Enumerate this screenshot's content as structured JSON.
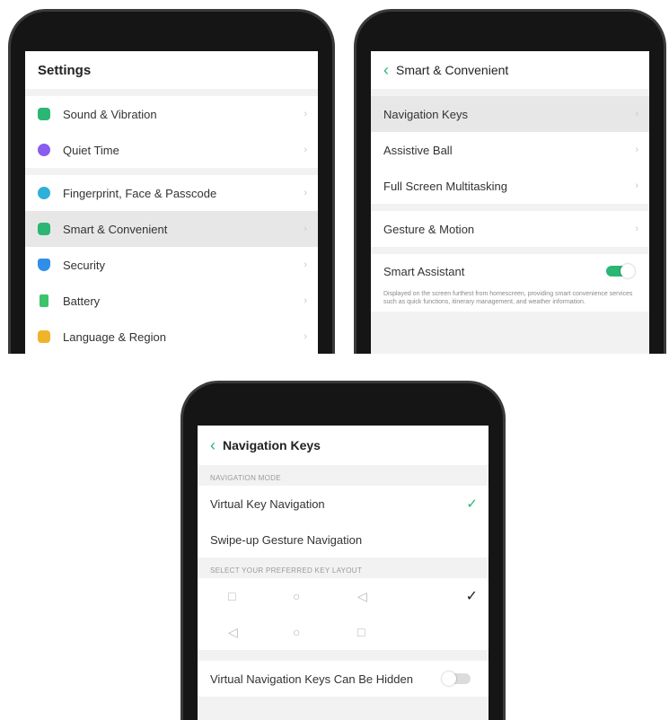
{
  "colors": {
    "accent": "#2bb673"
  },
  "phone1": {
    "title": "Settings",
    "group1": [
      {
        "label": "Sound & Vibration",
        "icon": "speaker-icon",
        "color": "#2bb673"
      },
      {
        "label": "Quiet Time",
        "icon": "moon-icon",
        "color": "#8a5cf0"
      }
    ],
    "group2": [
      {
        "label": "Fingerprint, Face & Passcode",
        "icon": "fingerprint-icon",
        "color": "#2fb0d8"
      },
      {
        "label": "Smart & Convenient",
        "icon": "smart-icon",
        "color": "#2bb673"
      },
      {
        "label": "Security",
        "icon": "shield-icon",
        "color": "#2f8fe8"
      },
      {
        "label": "Battery",
        "icon": "battery-icon",
        "color": "#3cc46b"
      },
      {
        "label": "Language & Region",
        "icon": "language-icon",
        "color": "#f0b429"
      }
    ]
  },
  "phone2": {
    "title": "Smart & Convenient",
    "group1": [
      "Navigation Keys",
      "Assistive Ball",
      "Full Screen Multitasking"
    ],
    "group2": [
      "Gesture & Motion"
    ],
    "smart_assistant": {
      "label": "Smart Assistant",
      "enabled": true,
      "description": "Displayed on the screen furthest from homescreen, providing smart convenience services such as quick functions, itinerary management, and weather information."
    }
  },
  "phone3": {
    "title": "Navigation Keys",
    "header_mode": "NAVIGATION MODE",
    "mode_virtual": "Virtual Key Navigation",
    "mode_swipe": "Swipe-up Gesture Navigation",
    "header_layout": "SELECT YOUR PREFERRED KEY LAYOUT",
    "layout1": [
      "□",
      "○",
      "◁"
    ],
    "layout2": [
      "◁",
      "○",
      "□"
    ],
    "hidden_label": "Virtual Navigation Keys Can Be Hidden",
    "hidden_enabled": false
  }
}
